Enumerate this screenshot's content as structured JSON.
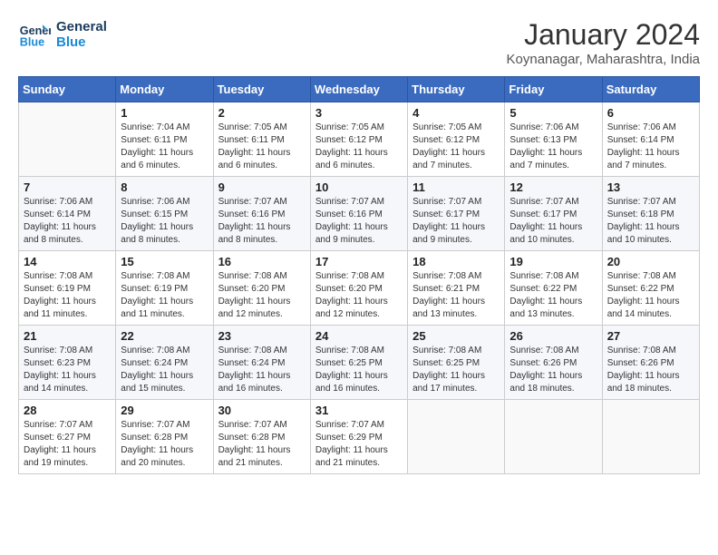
{
  "header": {
    "logo_line1": "General",
    "logo_line2": "Blue",
    "title": "January 2024",
    "subtitle": "Koynanagar, Maharashtra, India"
  },
  "weekdays": [
    "Sunday",
    "Monday",
    "Tuesday",
    "Wednesday",
    "Thursday",
    "Friday",
    "Saturday"
  ],
  "weeks": [
    [
      {
        "day": "",
        "sunrise": "",
        "sunset": "",
        "daylight": ""
      },
      {
        "day": "1",
        "sunrise": "Sunrise: 7:04 AM",
        "sunset": "Sunset: 6:11 PM",
        "daylight": "Daylight: 11 hours and 6 minutes."
      },
      {
        "day": "2",
        "sunrise": "Sunrise: 7:05 AM",
        "sunset": "Sunset: 6:11 PM",
        "daylight": "Daylight: 11 hours and 6 minutes."
      },
      {
        "day": "3",
        "sunrise": "Sunrise: 7:05 AM",
        "sunset": "Sunset: 6:12 PM",
        "daylight": "Daylight: 11 hours and 6 minutes."
      },
      {
        "day": "4",
        "sunrise": "Sunrise: 7:05 AM",
        "sunset": "Sunset: 6:12 PM",
        "daylight": "Daylight: 11 hours and 7 minutes."
      },
      {
        "day": "5",
        "sunrise": "Sunrise: 7:06 AM",
        "sunset": "Sunset: 6:13 PM",
        "daylight": "Daylight: 11 hours and 7 minutes."
      },
      {
        "day": "6",
        "sunrise": "Sunrise: 7:06 AM",
        "sunset": "Sunset: 6:14 PM",
        "daylight": "Daylight: 11 hours and 7 minutes."
      }
    ],
    [
      {
        "day": "7",
        "sunrise": "Sunrise: 7:06 AM",
        "sunset": "Sunset: 6:14 PM",
        "daylight": "Daylight: 11 hours and 8 minutes."
      },
      {
        "day": "8",
        "sunrise": "Sunrise: 7:06 AM",
        "sunset": "Sunset: 6:15 PM",
        "daylight": "Daylight: 11 hours and 8 minutes."
      },
      {
        "day": "9",
        "sunrise": "Sunrise: 7:07 AM",
        "sunset": "Sunset: 6:16 PM",
        "daylight": "Daylight: 11 hours and 8 minutes."
      },
      {
        "day": "10",
        "sunrise": "Sunrise: 7:07 AM",
        "sunset": "Sunset: 6:16 PM",
        "daylight": "Daylight: 11 hours and 9 minutes."
      },
      {
        "day": "11",
        "sunrise": "Sunrise: 7:07 AM",
        "sunset": "Sunset: 6:17 PM",
        "daylight": "Daylight: 11 hours and 9 minutes."
      },
      {
        "day": "12",
        "sunrise": "Sunrise: 7:07 AM",
        "sunset": "Sunset: 6:17 PM",
        "daylight": "Daylight: 11 hours and 10 minutes."
      },
      {
        "day": "13",
        "sunrise": "Sunrise: 7:07 AM",
        "sunset": "Sunset: 6:18 PM",
        "daylight": "Daylight: 11 hours and 10 minutes."
      }
    ],
    [
      {
        "day": "14",
        "sunrise": "Sunrise: 7:08 AM",
        "sunset": "Sunset: 6:19 PM",
        "daylight": "Daylight: 11 hours and 11 minutes."
      },
      {
        "day": "15",
        "sunrise": "Sunrise: 7:08 AM",
        "sunset": "Sunset: 6:19 PM",
        "daylight": "Daylight: 11 hours and 11 minutes."
      },
      {
        "day": "16",
        "sunrise": "Sunrise: 7:08 AM",
        "sunset": "Sunset: 6:20 PM",
        "daylight": "Daylight: 11 hours and 12 minutes."
      },
      {
        "day": "17",
        "sunrise": "Sunrise: 7:08 AM",
        "sunset": "Sunset: 6:20 PM",
        "daylight": "Daylight: 11 hours and 12 minutes."
      },
      {
        "day": "18",
        "sunrise": "Sunrise: 7:08 AM",
        "sunset": "Sunset: 6:21 PM",
        "daylight": "Daylight: 11 hours and 13 minutes."
      },
      {
        "day": "19",
        "sunrise": "Sunrise: 7:08 AM",
        "sunset": "Sunset: 6:22 PM",
        "daylight": "Daylight: 11 hours and 13 minutes."
      },
      {
        "day": "20",
        "sunrise": "Sunrise: 7:08 AM",
        "sunset": "Sunset: 6:22 PM",
        "daylight": "Daylight: 11 hours and 14 minutes."
      }
    ],
    [
      {
        "day": "21",
        "sunrise": "Sunrise: 7:08 AM",
        "sunset": "Sunset: 6:23 PM",
        "daylight": "Daylight: 11 hours and 14 minutes."
      },
      {
        "day": "22",
        "sunrise": "Sunrise: 7:08 AM",
        "sunset": "Sunset: 6:24 PM",
        "daylight": "Daylight: 11 hours and 15 minutes."
      },
      {
        "day": "23",
        "sunrise": "Sunrise: 7:08 AM",
        "sunset": "Sunset: 6:24 PM",
        "daylight": "Daylight: 11 hours and 16 minutes."
      },
      {
        "day": "24",
        "sunrise": "Sunrise: 7:08 AM",
        "sunset": "Sunset: 6:25 PM",
        "daylight": "Daylight: 11 hours and 16 minutes."
      },
      {
        "day": "25",
        "sunrise": "Sunrise: 7:08 AM",
        "sunset": "Sunset: 6:25 PM",
        "daylight": "Daylight: 11 hours and 17 minutes."
      },
      {
        "day": "26",
        "sunrise": "Sunrise: 7:08 AM",
        "sunset": "Sunset: 6:26 PM",
        "daylight": "Daylight: 11 hours and 18 minutes."
      },
      {
        "day": "27",
        "sunrise": "Sunrise: 7:08 AM",
        "sunset": "Sunset: 6:26 PM",
        "daylight": "Daylight: 11 hours and 18 minutes."
      }
    ],
    [
      {
        "day": "28",
        "sunrise": "Sunrise: 7:07 AM",
        "sunset": "Sunset: 6:27 PM",
        "daylight": "Daylight: 11 hours and 19 minutes."
      },
      {
        "day": "29",
        "sunrise": "Sunrise: 7:07 AM",
        "sunset": "Sunset: 6:28 PM",
        "daylight": "Daylight: 11 hours and 20 minutes."
      },
      {
        "day": "30",
        "sunrise": "Sunrise: 7:07 AM",
        "sunset": "Sunset: 6:28 PM",
        "daylight": "Daylight: 11 hours and 21 minutes."
      },
      {
        "day": "31",
        "sunrise": "Sunrise: 7:07 AM",
        "sunset": "Sunset: 6:29 PM",
        "daylight": "Daylight: 11 hours and 21 minutes."
      },
      {
        "day": "",
        "sunrise": "",
        "sunset": "",
        "daylight": ""
      },
      {
        "day": "",
        "sunrise": "",
        "sunset": "",
        "daylight": ""
      },
      {
        "day": "",
        "sunrise": "",
        "sunset": "",
        "daylight": ""
      }
    ]
  ]
}
